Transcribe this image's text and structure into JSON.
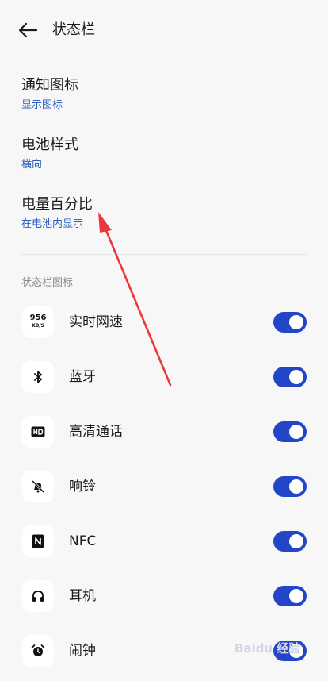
{
  "header": {
    "title": "状态栏"
  },
  "settings": [
    {
      "label": "通知图标",
      "value": "显示图标"
    },
    {
      "label": "电池样式",
      "value": "横向"
    },
    {
      "label": "电量百分比",
      "value": "在电池内显示"
    }
  ],
  "section_title": "状态栏图标",
  "speed_icon": {
    "top": "956",
    "bottom": "KB/S"
  },
  "items": [
    {
      "label": "实时网速",
      "icon": "network-speed-icon",
      "enabled": true
    },
    {
      "label": "蓝牙",
      "icon": "bluetooth-icon",
      "enabled": true
    },
    {
      "label": "高清通话",
      "icon": "hd-icon",
      "enabled": true
    },
    {
      "label": "响铃",
      "icon": "bell-off-icon",
      "enabled": true
    },
    {
      "label": "NFC",
      "icon": "nfc-icon",
      "enabled": true
    },
    {
      "label": "耳机",
      "icon": "headphones-icon",
      "enabled": true
    },
    {
      "label": "闹钟",
      "icon": "alarm-icon",
      "enabled": true
    }
  ],
  "watermark": "Baidu 经验",
  "colors": {
    "accent": "#2346c8",
    "link": "#2b5dbd",
    "annotation": "#e8383d"
  }
}
